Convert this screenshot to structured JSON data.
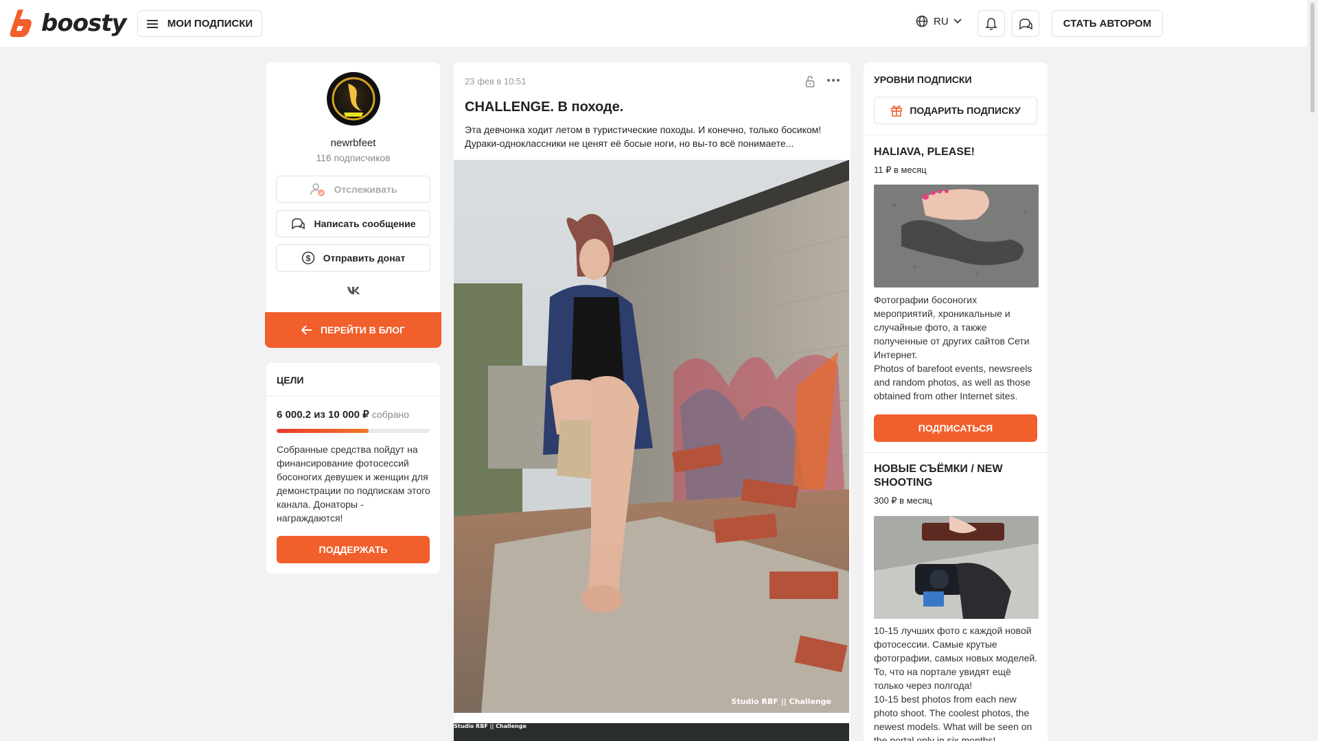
{
  "header": {
    "logo_text": "boosty",
    "subs_label": "МОИ ПОДПИСКИ",
    "language": "RU",
    "become_author_label": "СТАТЬ АВТОРОМ"
  },
  "profile": {
    "username": "newrbfeet",
    "subscribers": "116 подписчиков",
    "follow_label": "Отслеживать",
    "message_label": "Написать сообщение",
    "donate_label": "Отправить донат",
    "social": "VK",
    "blog_label": "ПЕРЕЙТИ В БЛОГ"
  },
  "goals": {
    "title": "ЦЕЛИ",
    "amount": "6 000.2 из 10 000 ₽",
    "collected_label": "собрано",
    "progress": 0.60002,
    "description": "Собранные средства пойдут на финансирование фотосессий босоногих девушек и женщин для демонстрации по подпискам этого канала. Донаторы - награждаются!",
    "support_label": "ПОДДЕРЖАТЬ"
  },
  "post": {
    "date": "23 фев в 10:51",
    "title": "CHALLENGE. В походе.",
    "text": "Эта девчонка ходит летом в туристические походы. И конечно, только босиком! Дураки-одноклассники не ценят её босые ноги, но вы-то всё понимаете...",
    "watermark": "Studio RBF || Challenge",
    "watermark2": "Studio RBF || Challenge"
  },
  "tiers": {
    "title": "УРОВНИ ПОДПИСКИ",
    "gift_label": "ПОДАРИТЬ ПОДПИСКУ",
    "items": [
      {
        "name": "HALIAVA, PLEASE!",
        "price": "11 ₽ в месяц",
        "description": "Фотографии босоногих мероприятий, хроникальные и случайные фото, а также полученные от других сайтов Сети Интернет.\nPhotos of barefoot events, newsreels and random photos, as well as those obtained from other Internet sites.",
        "button": "ПОДПИСАТЬСЯ"
      },
      {
        "name": "НОВЫЕ СЪЁМКИ / NEW SHOOTING",
        "price": "300 ₽ в месяц",
        "description": "10-15 лучших фото с каждой новой фотосессии. Самые крутые фотографии, самых новых моделей. То, что на портале увидят ещё только через полгода!\n10-15 best photos from each new photo shoot. The coolest photos, the newest models. What will be seen on the portal only in six months!"
      }
    ]
  },
  "colors": {
    "accent": "#f15f2c",
    "background": "#f2f2f3"
  }
}
